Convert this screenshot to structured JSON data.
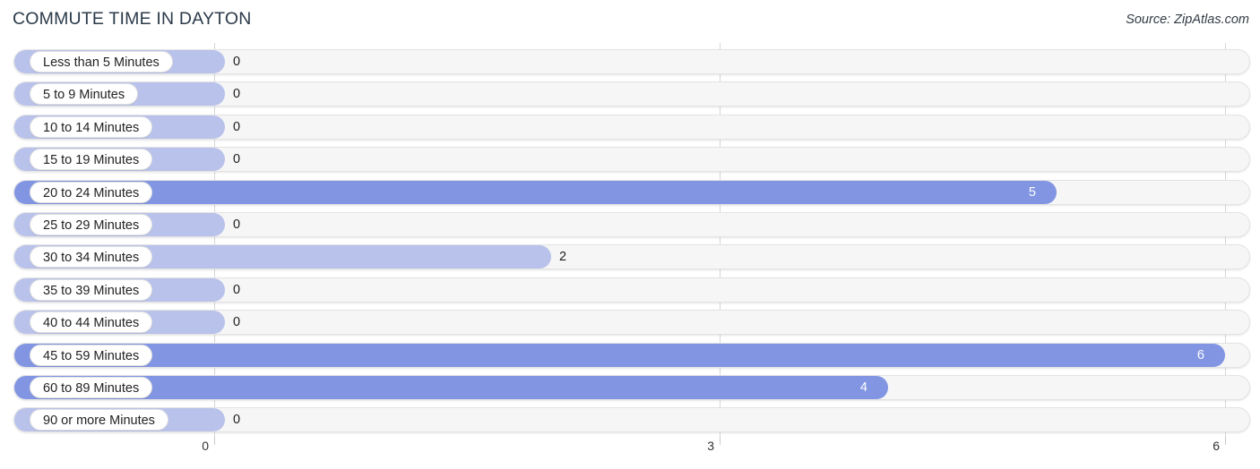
{
  "header": {
    "title": "COMMUTE TIME IN DAYTON",
    "source": "Source: ZipAtlas.com"
  },
  "chart_data": {
    "type": "bar",
    "orientation": "horizontal",
    "title": "COMMUTE TIME IN DAYTON",
    "xlabel": "",
    "ylabel": "",
    "xlim": [
      0,
      6
    ],
    "ticks": [
      "0",
      "3",
      "6"
    ],
    "tick_values": [
      0,
      3,
      6
    ],
    "grid": true,
    "legend": null,
    "categories": [
      "Less than 5 Minutes",
      "5 to 9 Minutes",
      "10 to 14 Minutes",
      "15 to 19 Minutes",
      "20 to 24 Minutes",
      "25 to 29 Minutes",
      "30 to 34 Minutes",
      "35 to 39 Minutes",
      "40 to 44 Minutes",
      "45 to 59 Minutes",
      "60 to 89 Minutes",
      "90 or more Minutes"
    ],
    "values": [
      0,
      0,
      0,
      0,
      5,
      0,
      2,
      0,
      0,
      6,
      4,
      0
    ],
    "value_labels": [
      "0",
      "0",
      "0",
      "0",
      "5",
      "0",
      "2",
      "0",
      "0",
      "6",
      "4",
      "0"
    ],
    "colors": {
      "bar_light": "#b9c2ea",
      "bar_dark": "#8195e2",
      "track": "#f6f6f6",
      "track_border": "#e3e3e3",
      "label_pill": "#ffffff",
      "gridline": "#d6d6d6",
      "title_text": "#2b3a4a",
      "value_text_inside": "#ffffff",
      "value_text_outside": "#1d1d1d"
    }
  }
}
